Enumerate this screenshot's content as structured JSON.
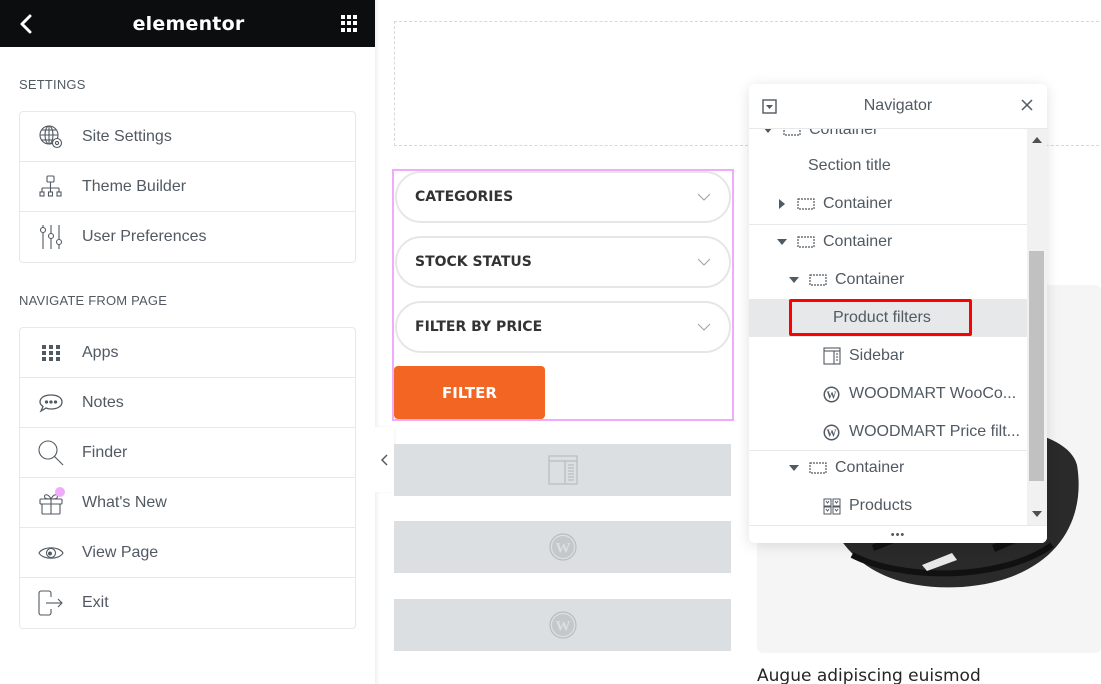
{
  "topbar": {
    "logo": "elementor",
    "back_icon": "chevron-left-icon",
    "apps_icon": "grid-icon"
  },
  "settings": {
    "label": "SETTINGS",
    "items": [
      {
        "label": "Site Settings",
        "icon": "globe-gear-icon"
      },
      {
        "label": "Theme Builder",
        "icon": "sitemap-icon"
      },
      {
        "label": "User Preferences",
        "icon": "sliders-icon"
      }
    ]
  },
  "navigate": {
    "label": "NAVIGATE FROM PAGE",
    "items": [
      {
        "label": "Apps",
        "icon": "grid-icon"
      },
      {
        "label": "Notes",
        "icon": "comment-icon"
      },
      {
        "label": "Finder",
        "icon": "search-icon"
      },
      {
        "label": "What's New",
        "icon": "gift-icon",
        "badge_color": "#f0abfc"
      },
      {
        "label": "View Page",
        "icon": "eye-icon"
      },
      {
        "label": "Exit",
        "icon": "exit-icon"
      }
    ]
  },
  "canvas": {
    "filters": [
      {
        "label": "CATEGORIES"
      },
      {
        "label": "STOCK STATUS"
      },
      {
        "label": "FILTER BY PRICE"
      }
    ],
    "filter_button": "FILTER",
    "accent_color": "#f26522",
    "selection_color": "#f0abfc",
    "placeholders": [
      {
        "icon": "sidebar-icon"
      },
      {
        "icon": "wordpress-icon"
      },
      {
        "icon": "wordpress-icon"
      }
    ],
    "product_title": "Augue adipiscing euismod"
  },
  "navigator": {
    "title": "Navigator",
    "items": [
      {
        "label": "Container",
        "icon": "container-icon",
        "caret": "down",
        "level": 0
      },
      {
        "label": "Section title",
        "icon": "",
        "caret": "",
        "level": 1
      },
      {
        "label": "Container",
        "icon": "container-icon",
        "caret": "right",
        "level": 1
      },
      {
        "label": "Container",
        "icon": "container-icon",
        "caret": "down",
        "level": 1
      },
      {
        "label": "Container",
        "icon": "container-icon",
        "caret": "down",
        "level": 2
      },
      {
        "label": "Product filters",
        "icon": "",
        "caret": "",
        "level": 3,
        "selected": true
      },
      {
        "label": "Sidebar",
        "icon": "sidebar-icon",
        "caret": "",
        "level": 3
      },
      {
        "label": "WOODMART WooCo...",
        "icon": "wordpress-icon",
        "caret": "",
        "level": 3
      },
      {
        "label": "WOODMART Price filt...",
        "icon": "wordpress-icon",
        "caret": "",
        "level": 3
      },
      {
        "label": "Container",
        "icon": "container-icon",
        "caret": "down",
        "level": 2
      },
      {
        "label": "Products",
        "icon": "products-grid-icon",
        "caret": "",
        "level": 3
      }
    ],
    "footer": "•••",
    "highlight_color": "#ff0000"
  }
}
